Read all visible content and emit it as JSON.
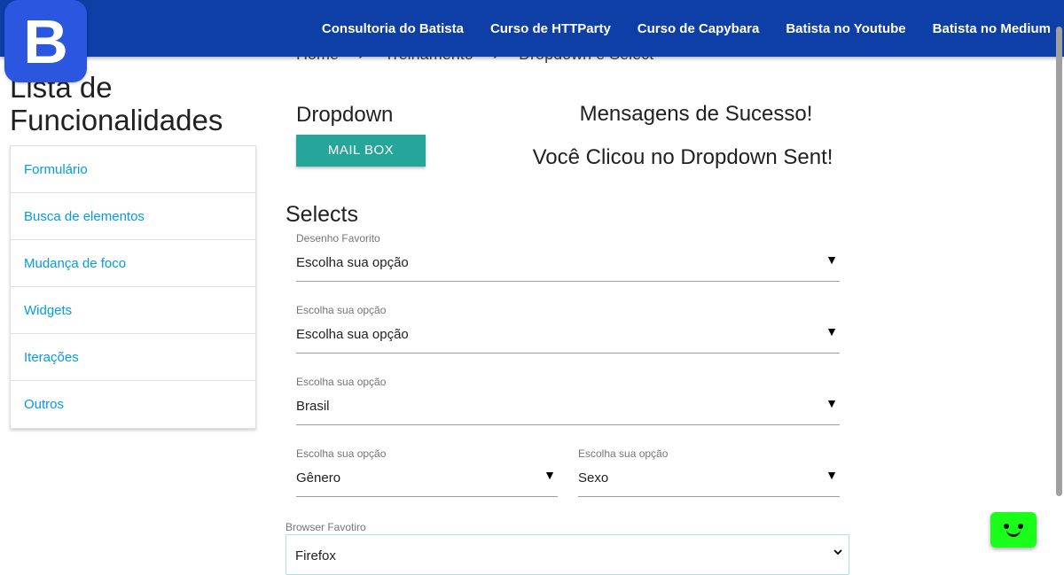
{
  "nav": {
    "logo_letter": "B",
    "links": [
      "Consultoria do Batista",
      "Curso de HTTParty",
      "Curso de Capybara",
      "Batista no Youtube",
      "Batista no Medium"
    ]
  },
  "breadcrumb": {
    "items": [
      "Home",
      "Treinamento",
      "Dropdown e Select"
    ],
    "separator": "›"
  },
  "sidebar": {
    "title_line1": "Lista de",
    "title_line2": "Funcionalidades",
    "items": [
      "Formulário",
      "Busca de elementos",
      "Mudança de foco",
      "Widgets",
      "Iterações",
      "Outros"
    ]
  },
  "dropdown": {
    "title": "Dropdown",
    "button_label": "MAIL BOX"
  },
  "success": {
    "title": "Mensagens de Sucesso!",
    "message": "Você Clicou no Dropdown Sent!"
  },
  "selects": {
    "title": "Selects",
    "fields": [
      {
        "label": "Desenho Favorito",
        "value": "Escolha sua opção"
      },
      {
        "label": "Escolha sua opção",
        "value": "Escolha sua opção"
      },
      {
        "label": "Escolha sua opção",
        "value": "Brasil"
      },
      {
        "label": "Escolha sua opção",
        "value": "Gênero"
      },
      {
        "label": "Escolha sua opção",
        "value": "Sexo"
      }
    ],
    "caret": "▼",
    "browser": {
      "label": "Browser Favotiro",
      "value": "Firefox"
    }
  }
}
